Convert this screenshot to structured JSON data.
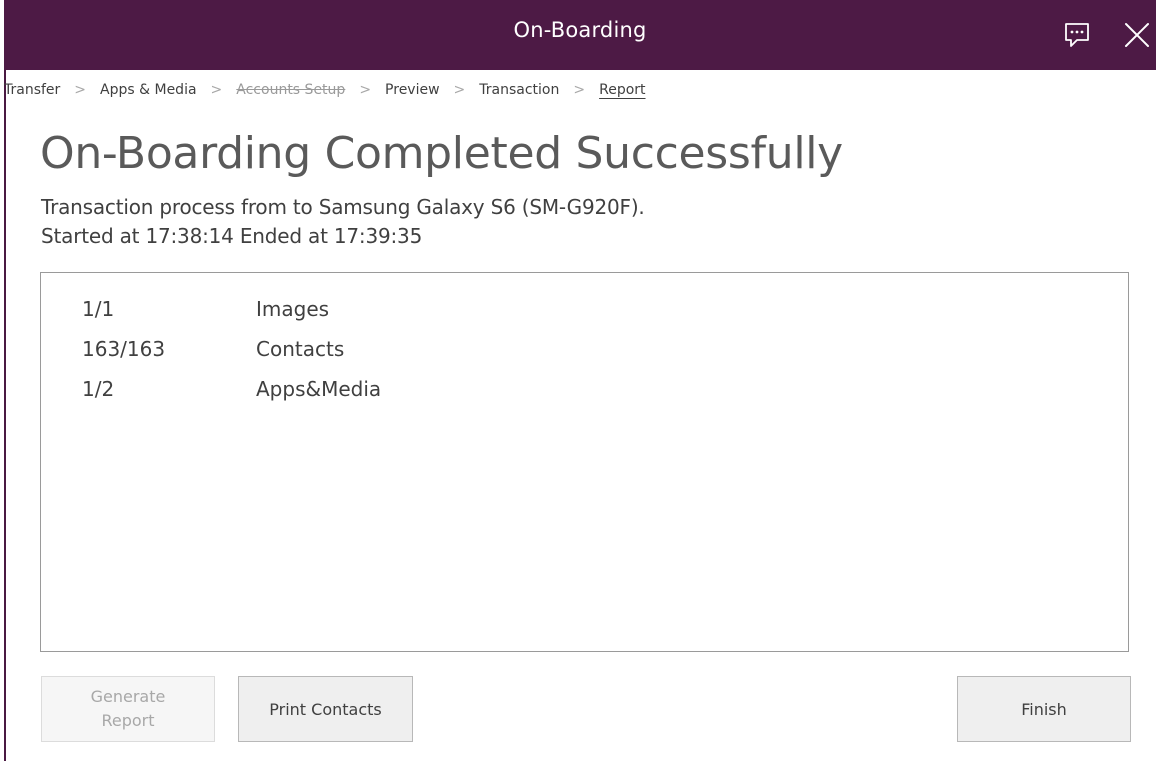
{
  "window": {
    "title": "On-Boarding"
  },
  "titlebar": {
    "chat_icon": "chat-bubble-icon",
    "close_icon": "close-icon"
  },
  "breadcrumb": {
    "items": [
      {
        "label": "Transfer",
        "state": "normal"
      },
      {
        "label": "Apps & Media",
        "state": "normal"
      },
      {
        "label": "Accounts Setup",
        "state": "disabled"
      },
      {
        "label": "Preview",
        "state": "normal"
      },
      {
        "label": "Transaction",
        "state": "normal"
      },
      {
        "label": "Report",
        "state": "current"
      }
    ],
    "separator": ">"
  },
  "main": {
    "heading": "On-Boarding Completed Successfully",
    "transaction_line": "Transaction process from to Samsung Galaxy S6 (SM-G920F).",
    "time_line": "Started at 17:38:14 Ended at 17:39:35"
  },
  "results": [
    {
      "count": "1/1",
      "label": "Images"
    },
    {
      "count": "163/163",
      "label": "Contacts"
    },
    {
      "count": "1/2",
      "label": "Apps&Media"
    }
  ],
  "buttons": {
    "generate_report_line1": "Generate",
    "generate_report_line2": "Report",
    "print_contacts": "Print Contacts",
    "finish": "Finish"
  },
  "colors": {
    "titlebar": "#4d1a45",
    "title_text": "#ffffff",
    "heading_text": "#5a5a5a",
    "body_text": "#404040"
  }
}
